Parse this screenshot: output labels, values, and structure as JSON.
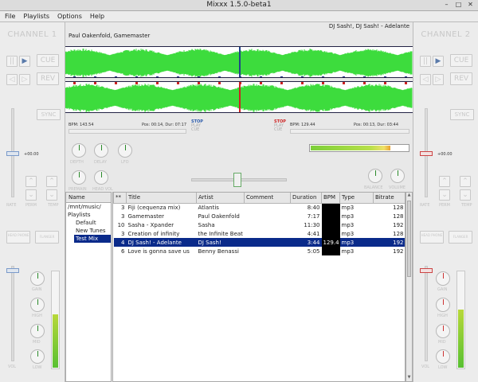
{
  "window": {
    "title": "Mixxx 1.5.0-beta1"
  },
  "menu": [
    "File",
    "Playlists",
    "Options",
    "Help"
  ],
  "colors": {
    "waveform": "#3ddc3d",
    "cursor": "#224488",
    "cue": "#cc2222",
    "selection": "#0a2a8a"
  },
  "channel1": {
    "label": "CHANNEL 1",
    "cue": "CUE",
    "rev": "REV",
    "sync": "SYNC",
    "rate_value": "+00.00",
    "rate_labels": [
      "RATE",
      "PERM",
      "TEMP"
    ],
    "headphone": "HEAD PHONE",
    "flanger": "FLANGER",
    "eq_labels": [
      "GAIN",
      "HIGH",
      "MID",
      "LOW"
    ],
    "vol_label": "VOL",
    "vu_level": 0.55
  },
  "channel2": {
    "label": "CHANNEL 2",
    "cue": "CUE",
    "rev": "REV",
    "sync": "SYNC",
    "rate_value": "+00.00",
    "rate_labels": [
      "RATE",
      "PERM",
      "TEMP"
    ],
    "headphone": "HEAD PHONE",
    "flanger": "FLANGER",
    "eq_labels": [
      "GAIN",
      "HIGH",
      "MID",
      "LOW"
    ],
    "vol_label": "VOL",
    "vu_level": 0.6
  },
  "deck1": {
    "track": "Paul Oakenfold, Gamemaster",
    "bpm": "BPM: 143.54",
    "pos": "Pos: 00:14, Dur: 07:17",
    "stop": "STOP",
    "play": "PLAY",
    "cue": "CUE"
  },
  "deck2": {
    "track": "DJ Sash!, DJ Sash! - Adelante",
    "bpm": "BPM: 129.44",
    "pos": "Pos: 00:13, Dur: 03:44",
    "stop": "STOP",
    "play": "PLAY",
    "cue": "CUE"
  },
  "effects": {
    "knobs": [
      "DEPTH",
      "DELAY",
      "LFO"
    ],
    "premain": "PREMAIN",
    "headvol": "HEAD VOL",
    "balance": "BALANCE",
    "volume": "VOLUME",
    "master_level": 0.82
  },
  "tree": {
    "header": "Name",
    "items": [
      {
        "label": "/mnt/music/",
        "indent": 0,
        "selected": false
      },
      {
        "label": "Playlists",
        "indent": 0,
        "selected": false
      },
      {
        "label": "Default",
        "indent": 1,
        "selected": false
      },
      {
        "label": "New Tunes",
        "indent": 1,
        "selected": false
      },
      {
        "label": "Test Mix",
        "indent": 1,
        "selected": true
      }
    ]
  },
  "library": {
    "columns": [
      "**",
      "Title",
      "Artist",
      "Comment",
      "Duration",
      "BPM",
      "Type",
      "Bitrate"
    ],
    "rows": [
      {
        "n": "3",
        "title": "Fiji (cequenza mix)",
        "artist": "Atlantis",
        "comment": "",
        "duration": "8:40",
        "bpm": "",
        "type": "mp3",
        "bitrate": "128",
        "selected": false
      },
      {
        "n": "3",
        "title": "Gamemaster",
        "artist": "Paul Oakenfold",
        "comment": "",
        "duration": "7:17",
        "bpm": "",
        "type": "mp3",
        "bitrate": "128",
        "selected": false
      },
      {
        "n": "10",
        "title": "Sasha - Xpander",
        "artist": "Sasha",
        "comment": "",
        "duration": "11:30",
        "bpm": "",
        "type": "mp3",
        "bitrate": "192",
        "selected": false
      },
      {
        "n": "3",
        "title": "Creation of infinity",
        "artist": "the Infinite Beat",
        "comment": "",
        "duration": "4:41",
        "bpm": "",
        "type": "mp3",
        "bitrate": "128",
        "selected": false
      },
      {
        "n": "4",
        "title": "DJ Sash! - Adelante",
        "artist": "DJ Sash!",
        "comment": "",
        "duration": "3:44",
        "bpm": "129.4",
        "type": "mp3",
        "bitrate": "192",
        "selected": true
      },
      {
        "n": "6",
        "title": "Love is gonna save us",
        "artist": "Benny Benassi",
        "comment": "",
        "duration": "5:05",
        "bpm": "",
        "type": "mp3",
        "bitrate": "192",
        "selected": false
      }
    ]
  }
}
